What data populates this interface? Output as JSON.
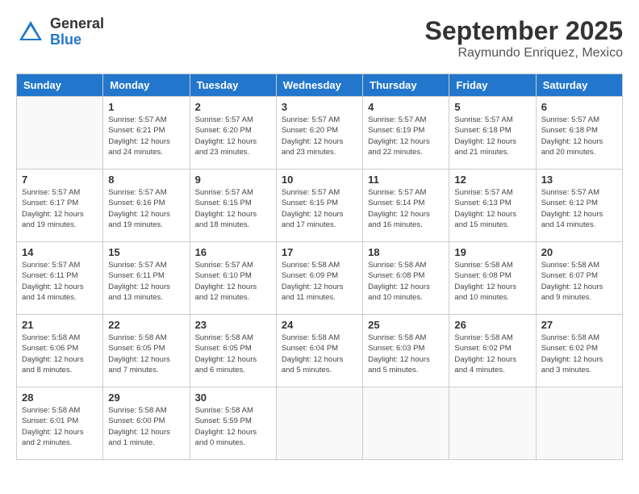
{
  "logo": {
    "line1": "General",
    "line2": "Blue"
  },
  "title": "September 2025",
  "subtitle": "Raymundo Enriquez, Mexico",
  "days_of_week": [
    "Sunday",
    "Monday",
    "Tuesday",
    "Wednesday",
    "Thursday",
    "Friday",
    "Saturday"
  ],
  "weeks": [
    [
      {
        "day": "",
        "info": ""
      },
      {
        "day": "1",
        "info": "Sunrise: 5:57 AM\nSunset: 6:21 PM\nDaylight: 12 hours\nand 24 minutes."
      },
      {
        "day": "2",
        "info": "Sunrise: 5:57 AM\nSunset: 6:20 PM\nDaylight: 12 hours\nand 23 minutes."
      },
      {
        "day": "3",
        "info": "Sunrise: 5:57 AM\nSunset: 6:20 PM\nDaylight: 12 hours\nand 23 minutes."
      },
      {
        "day": "4",
        "info": "Sunrise: 5:57 AM\nSunset: 6:19 PM\nDaylight: 12 hours\nand 22 minutes."
      },
      {
        "day": "5",
        "info": "Sunrise: 5:57 AM\nSunset: 6:18 PM\nDaylight: 12 hours\nand 21 minutes."
      },
      {
        "day": "6",
        "info": "Sunrise: 5:57 AM\nSunset: 6:18 PM\nDaylight: 12 hours\nand 20 minutes."
      }
    ],
    [
      {
        "day": "7",
        "info": "Sunrise: 5:57 AM\nSunset: 6:17 PM\nDaylight: 12 hours\nand 19 minutes."
      },
      {
        "day": "8",
        "info": "Sunrise: 5:57 AM\nSunset: 6:16 PM\nDaylight: 12 hours\nand 19 minutes."
      },
      {
        "day": "9",
        "info": "Sunrise: 5:57 AM\nSunset: 6:15 PM\nDaylight: 12 hours\nand 18 minutes."
      },
      {
        "day": "10",
        "info": "Sunrise: 5:57 AM\nSunset: 6:15 PM\nDaylight: 12 hours\nand 17 minutes."
      },
      {
        "day": "11",
        "info": "Sunrise: 5:57 AM\nSunset: 6:14 PM\nDaylight: 12 hours\nand 16 minutes."
      },
      {
        "day": "12",
        "info": "Sunrise: 5:57 AM\nSunset: 6:13 PM\nDaylight: 12 hours\nand 15 minutes."
      },
      {
        "day": "13",
        "info": "Sunrise: 5:57 AM\nSunset: 6:12 PM\nDaylight: 12 hours\nand 14 minutes."
      }
    ],
    [
      {
        "day": "14",
        "info": "Sunrise: 5:57 AM\nSunset: 6:11 PM\nDaylight: 12 hours\nand 14 minutes."
      },
      {
        "day": "15",
        "info": "Sunrise: 5:57 AM\nSunset: 6:11 PM\nDaylight: 12 hours\nand 13 minutes."
      },
      {
        "day": "16",
        "info": "Sunrise: 5:57 AM\nSunset: 6:10 PM\nDaylight: 12 hours\nand 12 minutes."
      },
      {
        "day": "17",
        "info": "Sunrise: 5:58 AM\nSunset: 6:09 PM\nDaylight: 12 hours\nand 11 minutes."
      },
      {
        "day": "18",
        "info": "Sunrise: 5:58 AM\nSunset: 6:08 PM\nDaylight: 12 hours\nand 10 minutes."
      },
      {
        "day": "19",
        "info": "Sunrise: 5:58 AM\nSunset: 6:08 PM\nDaylight: 12 hours\nand 10 minutes."
      },
      {
        "day": "20",
        "info": "Sunrise: 5:58 AM\nSunset: 6:07 PM\nDaylight: 12 hours\nand 9 minutes."
      }
    ],
    [
      {
        "day": "21",
        "info": "Sunrise: 5:58 AM\nSunset: 6:06 PM\nDaylight: 12 hours\nand 8 minutes."
      },
      {
        "day": "22",
        "info": "Sunrise: 5:58 AM\nSunset: 6:05 PM\nDaylight: 12 hours\nand 7 minutes."
      },
      {
        "day": "23",
        "info": "Sunrise: 5:58 AM\nSunset: 6:05 PM\nDaylight: 12 hours\nand 6 minutes."
      },
      {
        "day": "24",
        "info": "Sunrise: 5:58 AM\nSunset: 6:04 PM\nDaylight: 12 hours\nand 5 minutes."
      },
      {
        "day": "25",
        "info": "Sunrise: 5:58 AM\nSunset: 6:03 PM\nDaylight: 12 hours\nand 5 minutes."
      },
      {
        "day": "26",
        "info": "Sunrise: 5:58 AM\nSunset: 6:02 PM\nDaylight: 12 hours\nand 4 minutes."
      },
      {
        "day": "27",
        "info": "Sunrise: 5:58 AM\nSunset: 6:02 PM\nDaylight: 12 hours\nand 3 minutes."
      }
    ],
    [
      {
        "day": "28",
        "info": "Sunrise: 5:58 AM\nSunset: 6:01 PM\nDaylight: 12 hours\nand 2 minutes."
      },
      {
        "day": "29",
        "info": "Sunrise: 5:58 AM\nSunset: 6:00 PM\nDaylight: 12 hours\nand 1 minute."
      },
      {
        "day": "30",
        "info": "Sunrise: 5:58 AM\nSunset: 5:59 PM\nDaylight: 12 hours\nand 0 minutes."
      },
      {
        "day": "",
        "info": ""
      },
      {
        "day": "",
        "info": ""
      },
      {
        "day": "",
        "info": ""
      },
      {
        "day": "",
        "info": ""
      }
    ]
  ]
}
